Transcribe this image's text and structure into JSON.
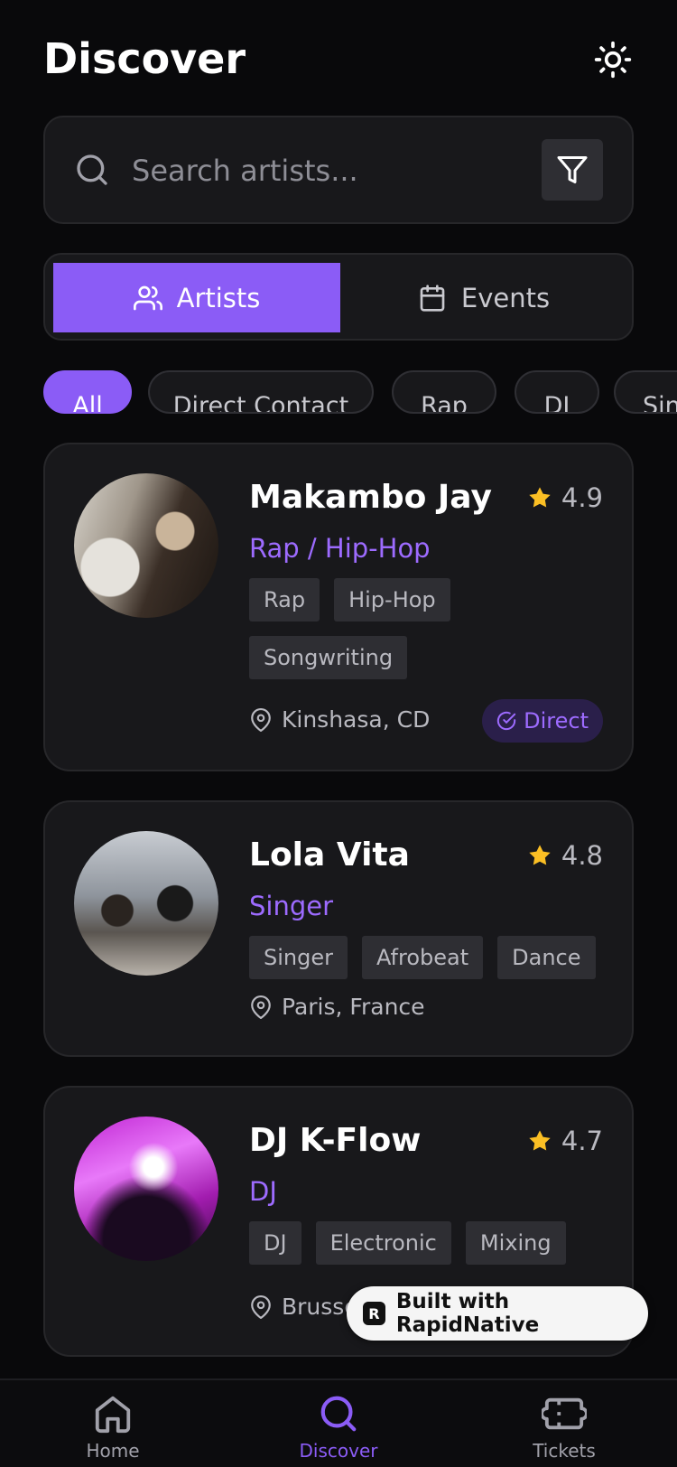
{
  "header": {
    "title": "Discover"
  },
  "search": {
    "placeholder": "Search artists..."
  },
  "tabs": [
    {
      "label": "Artists",
      "active": true
    },
    {
      "label": "Events",
      "active": false
    }
  ],
  "chips": [
    "All",
    "Direct Contact",
    "Rap",
    "DJ",
    "Singer"
  ],
  "artists": [
    {
      "name": "Makambo Jay",
      "rating": "4.9",
      "genre": "Rap / Hip-Hop",
      "tags": [
        "Rap",
        "Hip-Hop",
        "Songwriting"
      ],
      "location": "Kinshasa, CD",
      "badge": "Direct"
    },
    {
      "name": "Lola Vita",
      "rating": "4.8",
      "genre": "Singer",
      "tags": [
        "Singer",
        "Afrobeat",
        "Dance"
      ],
      "location": "Paris, France",
      "badge": ""
    },
    {
      "name": "DJ K-Flow",
      "rating": "4.7",
      "genre": "DJ",
      "tags": [
        "DJ",
        "Electronic",
        "Mixing"
      ],
      "location": "Brussels",
      "badge": ""
    }
  ],
  "promo": {
    "label": "Built with RapidNative"
  },
  "nav": [
    {
      "label": "Home"
    },
    {
      "label": "Discover"
    },
    {
      "label": "Tickets"
    }
  ],
  "colors": {
    "accent": "#8b5cf6",
    "star": "#fbbf24",
    "background": "#09090b",
    "card": "#18181b"
  },
  "icons": [
    "sun-icon",
    "search-icon",
    "filter-icon",
    "users-icon",
    "calendar-icon",
    "star-icon",
    "map-pin-icon",
    "check-badge-icon",
    "home-icon",
    "ticket-icon"
  ]
}
